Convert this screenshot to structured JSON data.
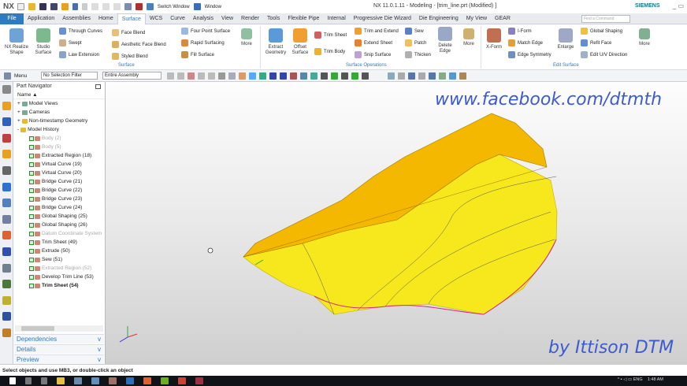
{
  "app": {
    "logo": "NX",
    "title": "NX 11.0.1.11 - Modeling - [trim_line.prt (Modified) ]",
    "brand": "SIEMENS",
    "switch_window": "Switch Window",
    "window": "Window"
  },
  "tabs": [
    "File",
    "Application",
    "Assemblies",
    "Home",
    "Surface",
    "WCS",
    "Curve",
    "Analysis",
    "View",
    "Render",
    "Tools",
    "Flexible Pipe",
    "Internal",
    "Progressive Die Wizard",
    "Die Engineering",
    "My View",
    "GEAR"
  ],
  "active_tab": "Surface",
  "find_command": {
    "placeholder": "Find a Command"
  },
  "ribbon": {
    "nx_realize": "NX Realize Shape",
    "studio_surface": "Studio Surface",
    "through_curves": "Through Curves",
    "swept": "Swept",
    "law_extension": "Law Extension",
    "face_blend": "Face Blend",
    "aesthetic_face_blend": "Aesthetic Face Blend",
    "styled_blend": "Styled Blend",
    "four_point": "Four Point Surface",
    "rapid_surfacing": "Rapid Surfacing",
    "fill_surface": "Fill Surface",
    "more": "More",
    "group_surface": "Surface",
    "extract_geometry": "Extract Geometry",
    "offset_surface": "Offset Surface",
    "trim_sheet": "Trim Sheet",
    "trim_body": "Trim Body",
    "trim_extend": "Trim and Extend",
    "extend_sheet": "Extend Sheet",
    "snip_surface": "Snip Surface",
    "sew": "Sew",
    "patch": "Patch",
    "thicken": "Thicken",
    "delete_edge": "Delete Edge",
    "group_surface_ops": "Surface Operations",
    "xform": "X-Form",
    "iform": "I-Form",
    "match_edge": "Match Edge",
    "edge_symmetry": "Edge Symmetry",
    "enlarge": "Enlarge",
    "global_shaping": "Global Shaping",
    "refit_face": "Refit Face",
    "edit_uv": "Edit U/V Direction",
    "group_edit_surface": "Edit Surface"
  },
  "toolbar": {
    "menu": "Menu",
    "selection_filter": "No Selection Filter",
    "assembly": "Entire Assembly"
  },
  "navigator": {
    "title": "Part Navigator",
    "column": "Name",
    "top": [
      {
        "label": "Model Views"
      },
      {
        "label": "Cameras"
      },
      {
        "label": "Non-timestamp Geometry"
      },
      {
        "label": "Model History"
      }
    ],
    "history": [
      {
        "label": "Body (2)",
        "state": "dim"
      },
      {
        "label": "Body (5)",
        "state": "dim"
      },
      {
        "label": "Extracted Region (18)",
        "state": ""
      },
      {
        "label": "Virtual Curve (19)",
        "state": ""
      },
      {
        "label": "Virtual Curve (20)",
        "state": ""
      },
      {
        "label": "Bridge Curve (21)",
        "state": ""
      },
      {
        "label": "Bridge Curve (22)",
        "state": ""
      },
      {
        "label": "Bridge Curve (23)",
        "state": ""
      },
      {
        "label": "Bridge Curve (24)",
        "state": ""
      },
      {
        "label": "Global Shaping (25)",
        "state": ""
      },
      {
        "label": "Global Shaping (26)",
        "state": ""
      },
      {
        "label": "Datum Coordinate System",
        "state": "dim"
      },
      {
        "label": "Trim Sheet (49)",
        "state": ""
      },
      {
        "label": "Extrude (50)",
        "state": ""
      },
      {
        "label": "Sew (51)",
        "state": ""
      },
      {
        "label": "Extracted Region (52)",
        "state": "dim"
      },
      {
        "label": "Develop Trim Line (53)",
        "state": ""
      },
      {
        "label": "Trim Sheet (54)",
        "state": "bold"
      }
    ],
    "panels": [
      "Dependencies",
      "Details",
      "Preview"
    ]
  },
  "watermark": {
    "top": "www.facebook.com/dtmth",
    "bottom": "by Ittison DTM"
  },
  "status": "Select objects and use MB3, or double-click an object",
  "taskbar": {
    "language": "ENG",
    "time": "1:48 AM"
  },
  "colors": {
    "accent": "#2e7bbf",
    "surface_yellow": "#f6e81c",
    "surface_orange": "#f5b800",
    "watermark": "#3b5bd0"
  }
}
